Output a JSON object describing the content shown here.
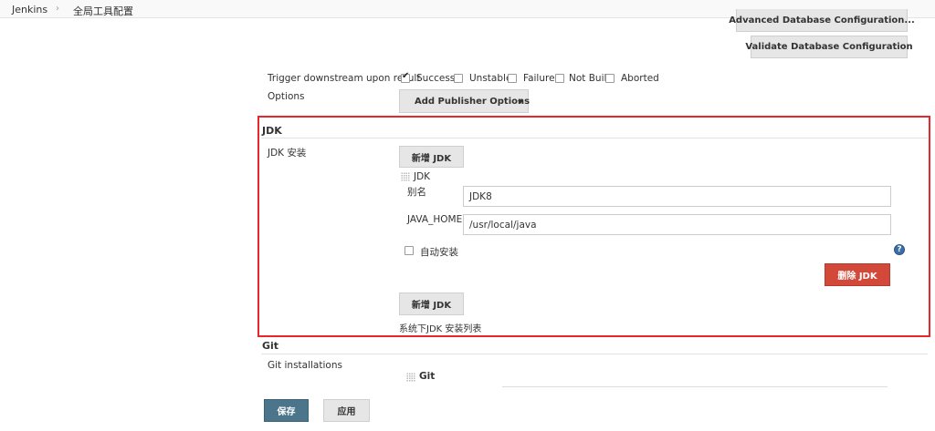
{
  "breadcrumb": {
    "home": "Jenkins",
    "separator": "›",
    "current": "全局工具配置"
  },
  "top_buttons": {
    "advanced_db": "Advanced Database Configuration...",
    "validate_db": "Validate Database Configuration"
  },
  "trigger": {
    "label": "Trigger downstream upon result",
    "options": [
      {
        "label": "Success",
        "checked": true
      },
      {
        "label": "Unstable",
        "checked": false
      },
      {
        "label": "Failure",
        "checked": false
      },
      {
        "label": "Not Built",
        "checked": false
      },
      {
        "label": "Aborted",
        "checked": false
      }
    ]
  },
  "options": {
    "label": "Options",
    "add_publisher": "Add Publisher Options"
  },
  "jdk": {
    "section_title": "JDK",
    "install_label": "JDK 安装",
    "add_button": "新增 JDK",
    "entry_title": "JDK",
    "name_label": "别名",
    "name_value": "JDK8",
    "home_label": "JAVA_HOME",
    "home_value": "/usr/local/java",
    "auto_install_label": "自动安装",
    "delete_button": "删除 JDK",
    "add_button_bottom": "新增 JDK",
    "list_caption": "系统下JDK 安装列表"
  },
  "git": {
    "section_title": "Git",
    "installations_label": "Git installations",
    "entry_title": "Git"
  },
  "footer": {
    "save": "保存",
    "apply": "应用"
  },
  "colors": {
    "highlight": "#e8262b",
    "delete": "#d24939",
    "save": "#4b758b",
    "help": "#3a6ea5"
  }
}
